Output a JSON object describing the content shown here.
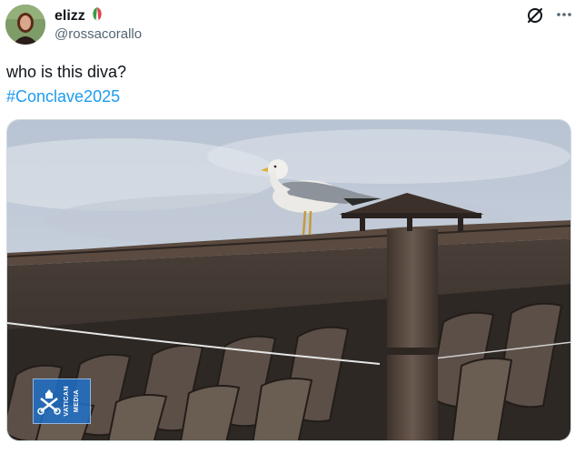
{
  "author": {
    "display_name": "elizz",
    "handle": "@rossacorallo"
  },
  "tweet": {
    "text": "who is this diva?",
    "hashtag": "#Conclave2025"
  },
  "media": {
    "watermark_line1": "VATICAN",
    "watermark_line2": "MEDIA"
  },
  "icons": {
    "flag": "italian-flag-icon",
    "grok": "grok-icon",
    "more": "more-icon"
  },
  "colors": {
    "link": "#1d9bf0",
    "handle": "#536471",
    "text": "#0f1419"
  }
}
